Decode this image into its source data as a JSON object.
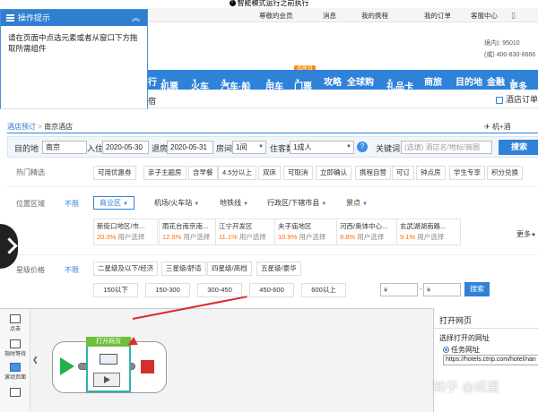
{
  "banner": {
    "text": "智能模式运行之前执行"
  },
  "topbar": {
    "items": [
      "尊敬的会员",
      "消息",
      "我的携程",
      "我的订单",
      "客服中心"
    ]
  },
  "help": {
    "title": "操作提示",
    "body": "请在页面中点选元素或者从窗口下方拖取所需组件"
  },
  "header": {
    "phone_prefix": "境内): 95010",
    "phone2": "(或) 400-830-6666"
  },
  "nav": {
    "badge": "品质日",
    "items": [
      "行",
      "机票",
      "火车",
      "汽车·船",
      "用车",
      "门票",
      "攻略",
      "全球购",
      "礼品卡",
      "商旅",
      "目的地",
      "金融",
      "更多"
    ]
  },
  "subnav": {
    "left": "宿",
    "right": "酒店订单"
  },
  "breadcrumb": {
    "root": "酒店预订",
    "sep": ">",
    "current": "南京酒店",
    "right": "机+酒"
  },
  "search": {
    "dest_label": "目的地",
    "dest": "南京",
    "checkin_label": "入住",
    "checkin": "2020-05-30",
    "checkout_label": "退房",
    "checkout": "2020-05-31",
    "rooms_label": "房间数",
    "rooms": "1间",
    "guests_label": "住客数",
    "guests": "1成人",
    "keyword_label": "关键词",
    "keyword_placeholder": "(选填) 酒店名/地标/商圈",
    "button": "搜索"
  },
  "hot": {
    "label": "热门精选",
    "chips": [
      "可用优惠券",
      "亲子主题房",
      "含早餐",
      "4.5分以上",
      "双床",
      "可取消",
      "立即确认",
      "携程自营",
      "可订",
      "钟点房",
      "学生专享",
      "积分兑换"
    ]
  },
  "location": {
    "label": "位置区域",
    "nolimit": "不限",
    "tabs": [
      "商业区",
      "机场/火车站",
      "地铁线",
      "行政区/下辖市县",
      "景点"
    ],
    "areas": [
      {
        "name": "新街口地区/市...",
        "pct": "20.3%",
        "users": "用户选择"
      },
      {
        "name": "雨花台南京南...",
        "pct": "12.9%",
        "users": "用户选择"
      },
      {
        "name": "江宁开发区",
        "pct": "11.1%",
        "users": "用户选择"
      },
      {
        "name": "夫子庙地区",
        "pct": "10.9%",
        "users": "用户选择"
      },
      {
        "name": "河西/奥体中心...",
        "pct": "9.8%",
        "users": "用户选择"
      },
      {
        "name": "玄武湖湖南路...",
        "pct": "9.1%",
        "users": "用户选择"
      }
    ],
    "more": "更多"
  },
  "stars": {
    "label": "星级价格",
    "nolimit": "不限",
    "levels": [
      "二星级及以下/经济",
      "三星级/舒适",
      "四星级/高档",
      "五星级/豪华"
    ],
    "prices": [
      "150以下",
      "150-300",
      "300-450",
      "450-600",
      "600以上"
    ],
    "min_placeholder": "¥",
    "max_placeholder": "¥",
    "button": "搜索"
  },
  "designer": {
    "tools": [
      "点击",
      "指时等待",
      "滚动页面",
      ""
    ],
    "node_title": "打开网页"
  },
  "props": {
    "title": "打开网页",
    "url_label": "选择打开的网址",
    "radio": "任务网址",
    "url": "https://hotels.ctrip.com/hotel/nan"
  },
  "watermark": "知乎 @咸蛋"
}
